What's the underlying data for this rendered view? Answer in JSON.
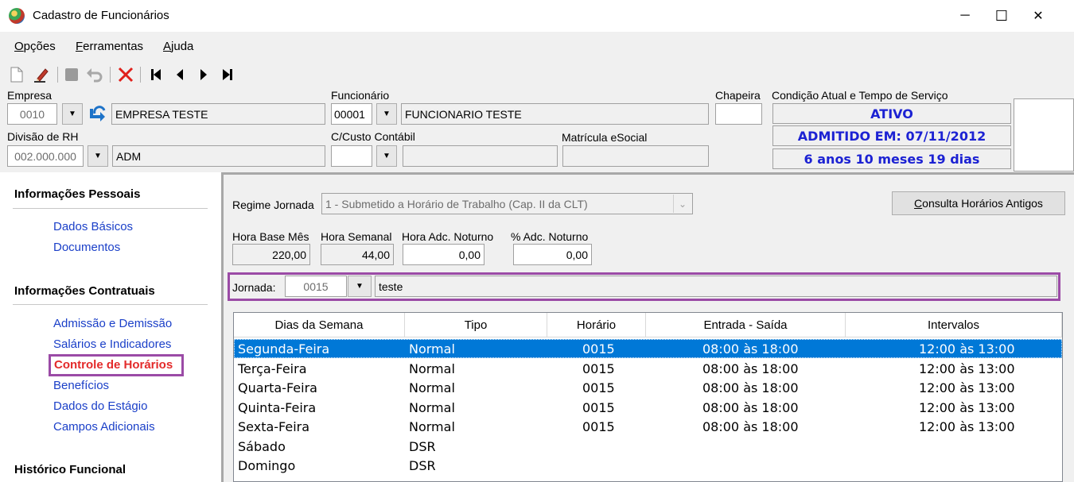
{
  "window": {
    "title": "Cadastro de Funcionários",
    "minimize_glyph": "─",
    "maximize_glyph": "☐",
    "close_glyph": "✕"
  },
  "menu": [
    {
      "accel": "O",
      "rest": "pções"
    },
    {
      "accel": "F",
      "rest": "erramentas"
    },
    {
      "accel": "A",
      "rest": "juda"
    }
  ],
  "toolbar": {
    "icons": [
      "new-document-icon",
      "edit-icon",
      "save-icon",
      "undo-icon",
      "delete-icon",
      "first-record-icon",
      "previous-record-icon",
      "next-record-icon",
      "last-record-icon"
    ]
  },
  "header": {
    "empresa_label": "Empresa",
    "empresa_code": "0010",
    "empresa_name": "EMPRESA TESTE",
    "funcionario_label": "Funcionário",
    "funcionario_code": "00001",
    "funcionario_name": "FUNCIONARIO TESTE",
    "chapeira_label": "Chapeira",
    "chapeira_value": "",
    "divisao_label": "Divisão de RH",
    "divisao_code": "002.000.000",
    "divisao_name": "ADM",
    "custo_label": "C/Custo Contábil",
    "matricula_label": "Matrícula eSocial",
    "condicao_label": "Condição Atual e Tempo de Serviço",
    "status": "ATIVO",
    "admitido": "ADMITIDO EM: 07/11/2012",
    "tempo": "6 anos 10 meses 19 dias",
    "status_color": "#1c22d3"
  },
  "sidebar": {
    "sections": [
      {
        "title": "Informações Pessoais",
        "items": [
          "Dados Básicos",
          "Documentos"
        ]
      },
      {
        "title": "Informações Contratuais",
        "items": [
          "Admissão e Demissão",
          "Salários e Indicadores",
          "Controle de Horários",
          "Benefícios",
          "Dados do Estágio",
          "Campos Adicionais"
        ]
      },
      {
        "title": "Histórico Funcional",
        "items": []
      }
    ],
    "active_item": "Controle de Horários",
    "active_color": "#e32a2a",
    "link_color": "#1a3fc8",
    "highlight_color": "#9b4ba6"
  },
  "main": {
    "regime_label": "Regime Jornada",
    "regime_value": "1 - Submetido a Horário de Trabalho (Cap. II da CLT)",
    "consulta_button_accel": "C",
    "consulta_button_rest": "onsulta Horários Antigos",
    "hora_base_label": "Hora Base Mês",
    "hora_base_value": "220,00",
    "hora_semanal_label": "Hora Semanal",
    "hora_semanal_value": "44,00",
    "hora_adc_label": "Hora Adc. Noturno",
    "hora_adc_value": "0,00",
    "pct_adc_label": "% Adc. Noturno",
    "pct_adc_value": "0,00",
    "jornada_label": "Jornada:",
    "jornada_code": "0015",
    "jornada_name": "teste"
  },
  "schedule": {
    "columns": [
      "Dias da Semana",
      "Tipo",
      "Horário",
      "Entrada - Saída",
      "Intervalos"
    ],
    "rows": [
      {
        "dia": "Segunda-Feira",
        "tipo": "Normal",
        "horario": "0015",
        "entrada_saida": "08:00 às 18:00",
        "intervalos": "12:00 às 13:00",
        "selected": true
      },
      {
        "dia": "Terça-Feira",
        "tipo": "Normal",
        "horario": "0015",
        "entrada_saida": "08:00 às 18:00",
        "intervalos": "12:00 às 13:00",
        "selected": false
      },
      {
        "dia": "Quarta-Feira",
        "tipo": "Normal",
        "horario": "0015",
        "entrada_saida": "08:00 às 18:00",
        "intervalos": "12:00 às 13:00",
        "selected": false
      },
      {
        "dia": "Quinta-Feira",
        "tipo": "Normal",
        "horario": "0015",
        "entrada_saida": "08:00 às 18:00",
        "intervalos": "12:00 às 13:00",
        "selected": false
      },
      {
        "dia": "Sexta-Feira",
        "tipo": "Normal",
        "horario": "0015",
        "entrada_saida": "08:00 às 18:00",
        "intervalos": "12:00 às 13:00",
        "selected": false
      },
      {
        "dia": "Sábado",
        "tipo": "DSR",
        "horario": "",
        "entrada_saida": "",
        "intervalos": "",
        "selected": false
      },
      {
        "dia": "Domingo",
        "tipo": "DSR",
        "horario": "",
        "entrada_saida": "",
        "intervalos": "",
        "selected": false
      }
    ],
    "selected_color": "#0078d7"
  }
}
